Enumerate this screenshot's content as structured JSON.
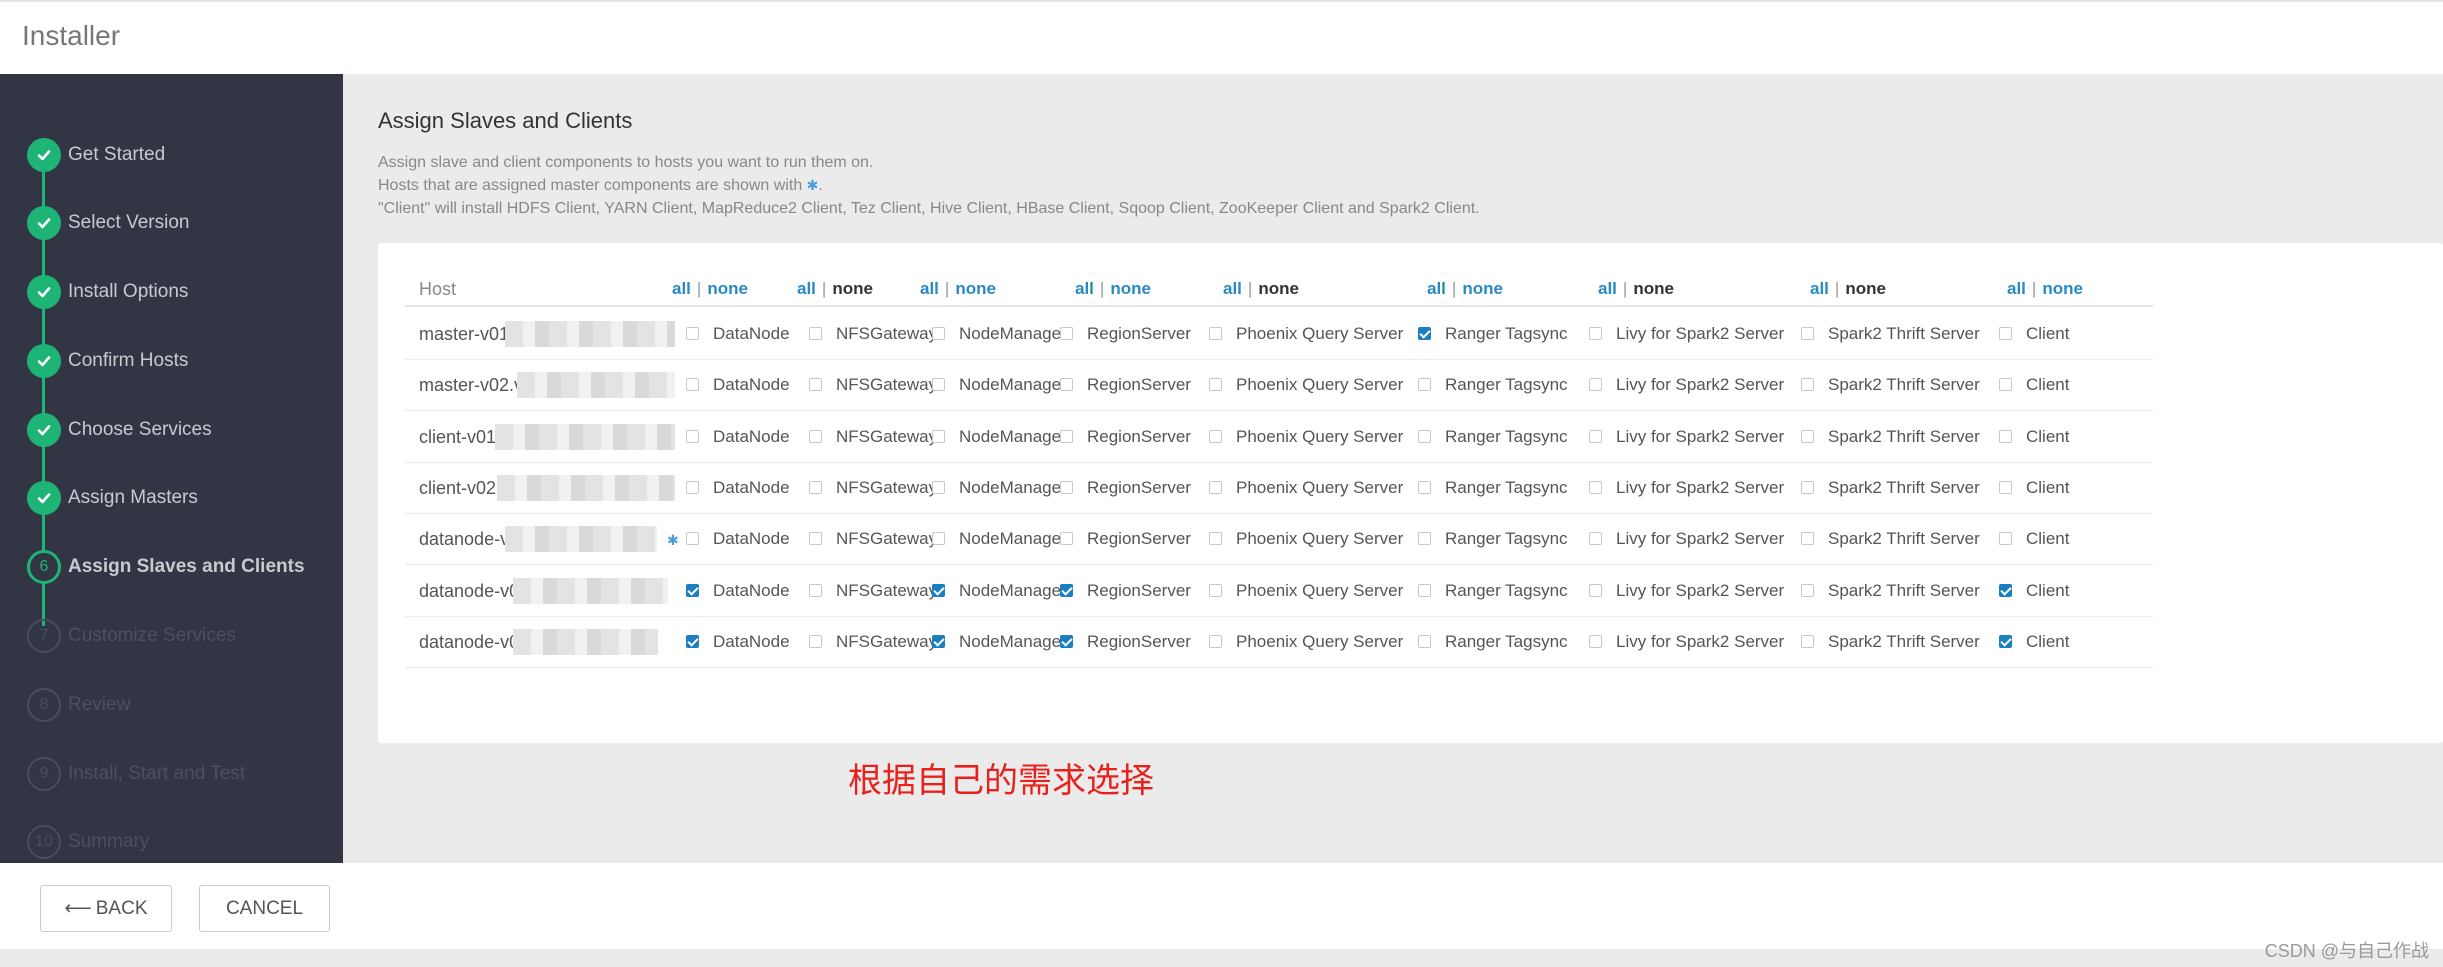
{
  "app": {
    "title": "Installer"
  },
  "steps": [
    {
      "num": "1",
      "label": "Get Started",
      "state": "done"
    },
    {
      "num": "2",
      "label": "Select Version",
      "state": "done"
    },
    {
      "num": "3",
      "label": "Install Options",
      "state": "done"
    },
    {
      "num": "4",
      "label": "Confirm Hosts",
      "state": "done"
    },
    {
      "num": "5",
      "label": "Choose Services",
      "state": "done"
    },
    {
      "num": "6",
      "label": "Assign Masters",
      "state": "done"
    },
    {
      "num": "6",
      "label": "Assign Slaves and Clients",
      "state": "current"
    },
    {
      "num": "7",
      "label": "Customize Services",
      "state": "future"
    },
    {
      "num": "8",
      "label": "Review",
      "state": "future"
    },
    {
      "num": "9",
      "label": "Install, Start and Test",
      "state": "future"
    },
    {
      "num": "10",
      "label": "Summary",
      "state": "future"
    }
  ],
  "main": {
    "title": "Assign Slaves and Clients",
    "desc1": "Assign slave and client components to hosts you want to run them on.",
    "desc2": "Hosts that are assigned master components are shown with ",
    "desc2_icon": "✱",
    "desc2_end": ".",
    "desc3": "\"Client\" will install HDFS Client, YARN Client, MapReduce2 Client, Tez Client, Hive Client, HBase Client, Sqoop Client, ZooKeeper Client and Spark2 Client."
  },
  "table": {
    "host_header": "Host",
    "all_label": "all",
    "none_label": "none",
    "separator": "|",
    "none_link_cols": [
      0,
      2,
      3,
      5,
      8
    ],
    "components": [
      "DataNode",
      "NFSGateway",
      "NodeManager",
      "RegionServer",
      "Phoenix Query Server",
      "Ranger Tagsync",
      "Livy for Spark2 Server",
      "Spark2 Thrift Server",
      "Client"
    ],
    "rows": [
      {
        "host": "master-v01",
        "checked": [
          false,
          false,
          false,
          false,
          false,
          true,
          false,
          false,
          false
        ]
      },
      {
        "host": "master-v02.v",
        "checked": [
          false,
          false,
          false,
          false,
          false,
          false,
          false,
          false,
          false
        ]
      },
      {
        "host": "client-v01",
        "checked": [
          false,
          false,
          false,
          false,
          false,
          false,
          false,
          false,
          false
        ]
      },
      {
        "host": "client-v02.",
        "checked": [
          false,
          false,
          false,
          false,
          false,
          false,
          false,
          false,
          false
        ]
      },
      {
        "host": "datanode-v",
        "checked": [
          false,
          false,
          false,
          false,
          false,
          false,
          false,
          false,
          false
        ],
        "master_icon": "✱"
      },
      {
        "host": "datanode-v0",
        "checked": [
          true,
          false,
          true,
          true,
          false,
          false,
          false,
          false,
          true
        ]
      },
      {
        "host": "datanode-v0",
        "checked": [
          true,
          false,
          true,
          true,
          false,
          false,
          false,
          false,
          true
        ]
      }
    ]
  },
  "annotation": "根据自己的需求选择",
  "footer": {
    "back_label": "BACK",
    "back_arrow": "⟵",
    "cancel_label": "CANCEL"
  },
  "watermark": "CSDN @与自己作战",
  "colors": {
    "sidebar": "#323544",
    "success": "#1eb475",
    "link": "#2a89c2",
    "annotation": "#e8211d"
  }
}
